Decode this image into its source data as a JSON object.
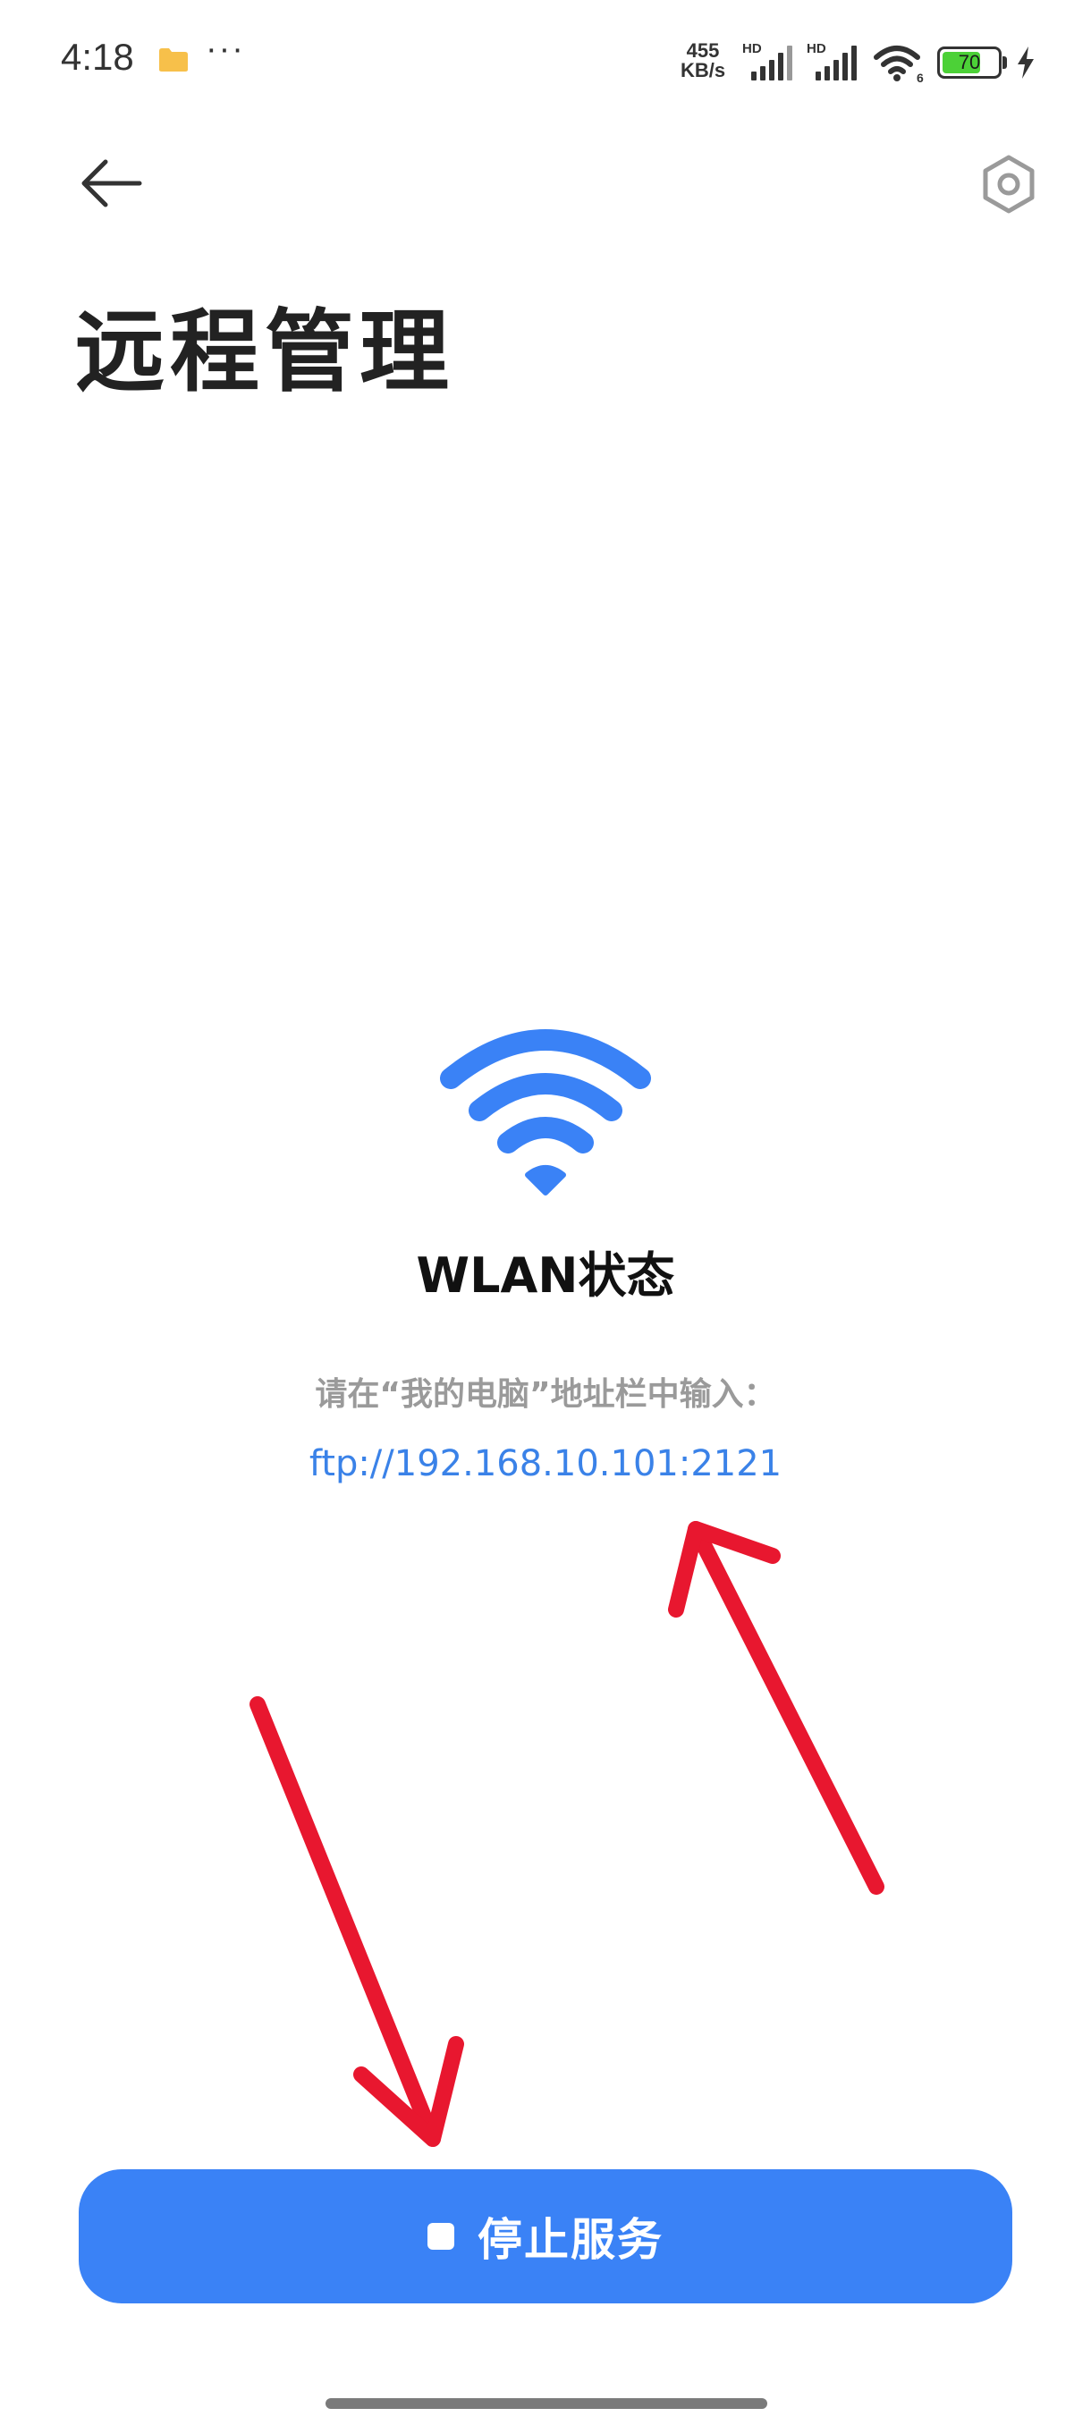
{
  "status_bar": {
    "time": "4:18",
    "dots": "···",
    "speed_value": "455",
    "speed_unit": "KB/s",
    "sim1_label": "HD",
    "sim2_label": "HD",
    "wifi_badge": "6",
    "battery": "70",
    "battery_fraction": 0.7,
    "icons": [
      "folder-icon",
      "signal-icon",
      "wifi-icon",
      "battery-icon",
      "charging-icon"
    ]
  },
  "header": {
    "title": "远程管理",
    "back_icon": "arrow-left-icon",
    "settings_icon": "hexagon-settings-icon"
  },
  "main": {
    "icon": "wifi-icon",
    "status_title": "WLAN状态",
    "instruction": "请在“我的电脑”地址栏中输入：",
    "ftp_address": "ftp://192.168.10.101:2121"
  },
  "footer": {
    "stop_button_label": "停止服务",
    "stop_icon": "stop-square-icon"
  },
  "colors": {
    "accent": "#3a82f6",
    "link": "#3a82e8",
    "annotation_arrow": "#e8172f",
    "battery_fill": "#4cd137"
  }
}
